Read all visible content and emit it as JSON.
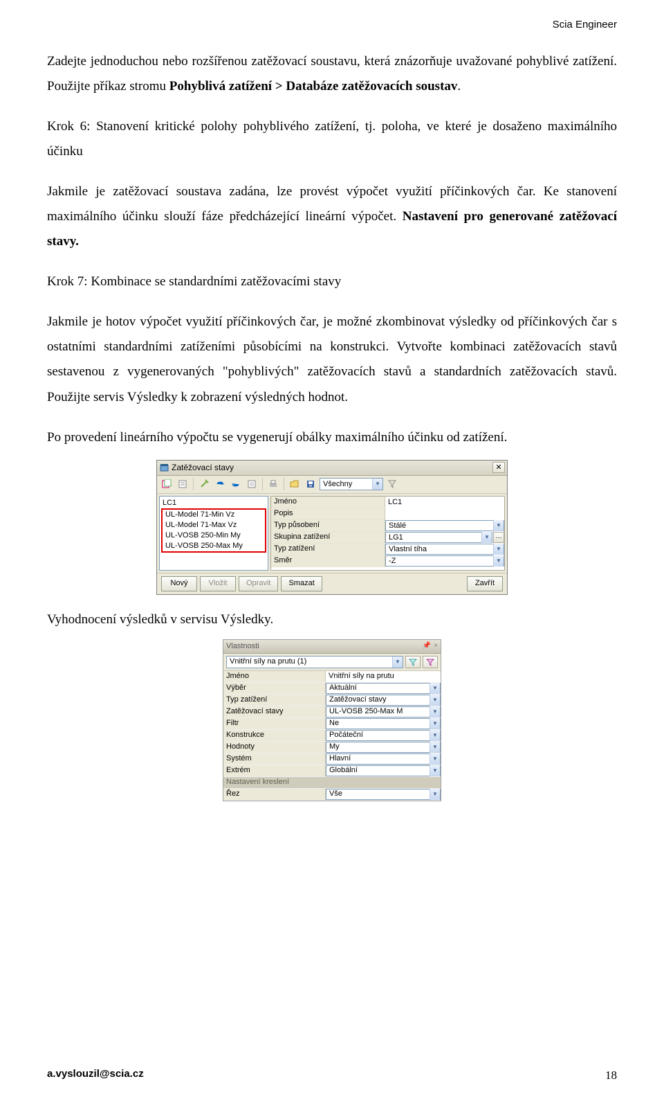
{
  "header": {
    "right": "Scia Engineer"
  },
  "body": {
    "p1a": "Zadejte jednoduchou nebo rozšířenou zatěžovací soustavu, která znázorňuje uvažované pohyblivé zatížení. Použijte příkaz stromu ",
    "p1b": "Pohyblivá zatížení > Databáze zatěžovacích soustav",
    "p1c": ".",
    "p2": "Krok 6: Stanovení kritické polohy pohyblivého zatížení, tj. poloha, ve které je dosaženo maximálního účinku",
    "p3a": "Jakmile je zatěžovací soustava zadána, lze provést výpočet využití příčinkových čar. Ke stanovení maximálního účinku slouží fáze předcházející lineární výpočet. ",
    "p3b": "Nastavení pro generované zatěžovací stavy.",
    "p4": "Krok 7: Kombinace se standardními zatěžovacími stavy",
    "p5": "Jakmile je hotov výpočet využití příčinkových čar, je možné zkombinovat výsledky od příčinkových čar s ostatními standardními zatíženími působícími na konstrukci. Vytvořte kombinaci zatěžovacích stavů sestavenou z vygenerovaných \"pohyblivých\" zatěžovacích stavů a standardních zatěžovacích stavů. Použijte servis Výsledky k zobrazení výsledných hodnot.",
    "p6": "Po provedení lineárního výpočtu se vygenerují obálky maximálního účinku od zatížení.",
    "p7": "Vyhodnocení výsledků v servisu Výsledky."
  },
  "dialog1": {
    "title": "Zatěžovací stavy",
    "toolbar_combo": "Všechny",
    "list": {
      "first": "LC1",
      "items": [
        "UL-Model 71-Min Vz",
        "UL-Model 71-Max Vz",
        "UL-VOSB 250-Min My",
        "UL-VOSB 250-Max My"
      ]
    },
    "props": [
      {
        "label": "Jméno",
        "value": "LC1",
        "combo": false
      },
      {
        "label": "Popis",
        "value": "",
        "combo": false
      },
      {
        "label": "Typ působení",
        "value": "Stálé",
        "combo": true
      },
      {
        "label": "Skupina zatížení",
        "value": "LG1",
        "combo": true,
        "extra": true
      },
      {
        "label": "Typ zatížení",
        "value": "Vlastní tíha",
        "combo": true
      },
      {
        "label": "Směr",
        "value": "-Z",
        "combo": true
      }
    ],
    "buttons": {
      "novy": "Nový",
      "vlozit": "Vložit",
      "opravit": "Opravit",
      "smazat": "Smazat",
      "zavrit": "Zavřít"
    }
  },
  "panel": {
    "title": "Vlastnosti",
    "pin_hint": "ꜛ ×",
    "selector": "Vnitřní síly na prutu (1)",
    "rows": [
      {
        "label": "Jméno",
        "value": "Vnitřní síly na prutu"
      },
      {
        "label": "Výběr",
        "value": "Aktuální"
      },
      {
        "label": "Typ zatížení",
        "value": "Zatěžovací stavy"
      },
      {
        "label": "Zatěžovací stavy",
        "value": "UL-VOSB 250-Max M"
      },
      {
        "label": "Filtr",
        "value": "Ne"
      },
      {
        "label": "Konstrukce",
        "value": "Počáteční"
      },
      {
        "label": "Hodnoty",
        "value": "My"
      },
      {
        "label": "Systém",
        "value": "Hlavní"
      },
      {
        "label": "Extrém",
        "value": "Globální"
      }
    ],
    "section": "Nastavení kreslení",
    "rows2": [
      {
        "label": "Řez",
        "value": "Vše"
      }
    ]
  },
  "footer": {
    "email": "a.vyslouzil@scia.cz",
    "page": "18"
  }
}
